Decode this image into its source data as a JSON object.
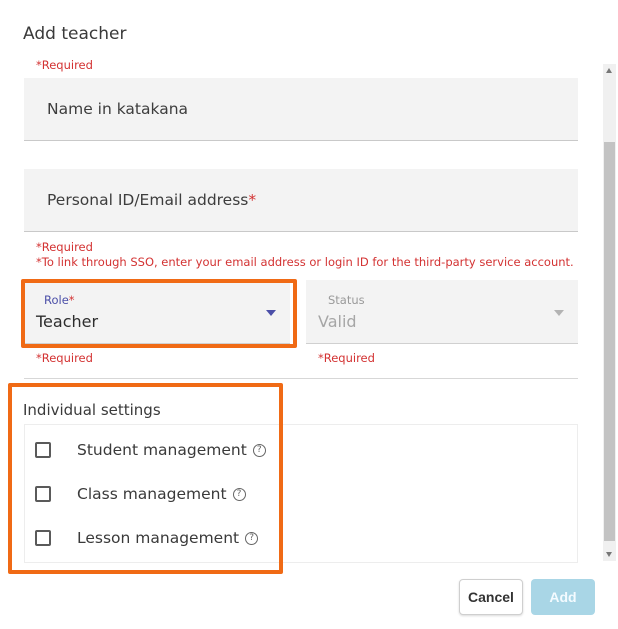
{
  "dialog": {
    "title": "Add teacher"
  },
  "form": {
    "top_required": "*Required",
    "name_katakana": {
      "placeholder": "Name in katakana"
    },
    "personal_id": {
      "placeholder": "Personal ID/Email address",
      "star": "*"
    },
    "personal_id_helper": {
      "required": "*Required",
      "note": "*To link through SSO, enter your email address or login ID for the third-party service account."
    },
    "role": {
      "label": "Role",
      "star": "*",
      "value": "Teacher",
      "required": "*Required"
    },
    "status": {
      "label": "Status",
      "value": "Valid",
      "required": "*Required"
    }
  },
  "individual_settings": {
    "title": "Individual settings",
    "options": [
      {
        "label": "Student management",
        "help": "?"
      },
      {
        "label": "Class management",
        "help": "?"
      },
      {
        "label": "Lesson management",
        "help": "?"
      }
    ]
  },
  "footer": {
    "cancel_label": "Cancel",
    "add_label": "Add"
  },
  "colors": {
    "accent": "#4b4fa8",
    "required": "#d33232",
    "highlight": "#f06a15",
    "add_button_disabled": "#a9d6e6"
  }
}
